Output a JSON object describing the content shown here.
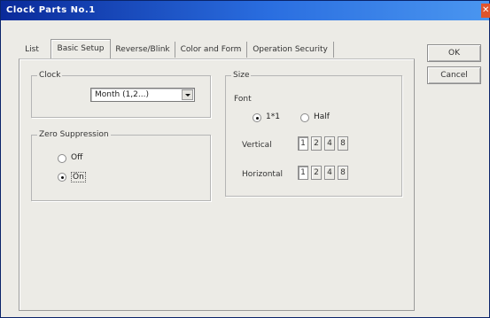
{
  "window": {
    "title": "Clock Parts No.1",
    "close_icon": "close-icon"
  },
  "tabs": [
    "List",
    "Basic Setup",
    "Reverse/Blink",
    "Color and Form",
    "Operation Security"
  ],
  "active_tab": "Basic Setup",
  "clock": {
    "legend": "Clock",
    "selected": "Month  (1,2...)"
  },
  "zero_suppression": {
    "legend": "Zero Suppression",
    "options": [
      {
        "label": "Off",
        "checked": false
      },
      {
        "label": "On",
        "checked": true
      }
    ]
  },
  "size": {
    "legend": "Size",
    "font_label": "Font",
    "font_options": [
      {
        "label": "1*1",
        "checked": true
      },
      {
        "label": "Half",
        "checked": false
      }
    ],
    "vertical_label": "Vertical",
    "horizontal_label": "Horizontal",
    "vertical_buttons": [
      "1",
      "2",
      "4",
      "8"
    ],
    "horizontal_buttons": [
      "1",
      "2",
      "4",
      "8"
    ],
    "vertical_selected": "1",
    "horizontal_selected": "1"
  },
  "buttons": {
    "ok": "OK",
    "cancel": "Cancel"
  },
  "colors": {
    "title_bar_start": "#0a2a9a",
    "title_bar_end": "#4a96f0",
    "dialog_bg": "#ecebe6"
  }
}
